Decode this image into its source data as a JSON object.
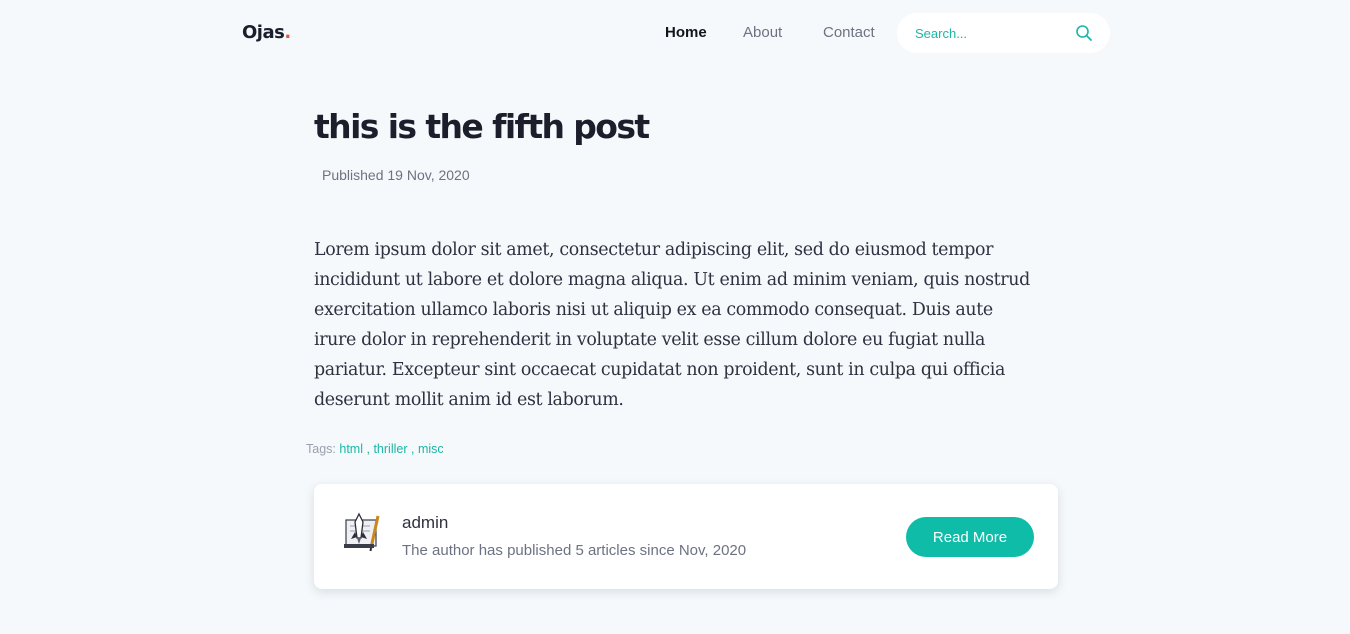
{
  "header": {
    "logo_text": "Ojas",
    "logo_dot": ".",
    "nav": [
      {
        "label": "Home",
        "active": true
      },
      {
        "label": "About",
        "active": false
      },
      {
        "label": "Contact",
        "active": false
      }
    ],
    "search": {
      "placeholder": "Search...",
      "value": "",
      "icon": "search-icon"
    }
  },
  "post": {
    "title": "this is the fifth post",
    "published": "Published 19 Nov, 2020",
    "body": "Lorem ipsum dolor sit amet, consectetur adipiscing elit, sed do eiusmod tempor incididunt ut labore et dolore magna aliqua. Ut enim ad minim veniam, quis nostrud exercitation ullamco laboris nisi ut aliquip ex ea commodo consequat. Duis aute irure dolor in reprehenderit in voluptate velit esse cillum dolore eu fugiat nulla pariatur. Excepteur sint occaecat cupidatat non proident, sunt in culpa qui officia deserunt mollit anim id est laborum.",
    "tags_label": "Tags:",
    "tags": [
      "html",
      "thriller",
      "misc"
    ],
    "tag_separator": ","
  },
  "author": {
    "name": "admin",
    "bio": "The author has published 5 articles since Nov, 2020",
    "avatar_icon": "writer-avatar-icon",
    "read_more_label": "Read More"
  },
  "colors": {
    "accent": "#0ebca8",
    "logo_dot": "#e0593f",
    "background": "#f5f9fb"
  }
}
